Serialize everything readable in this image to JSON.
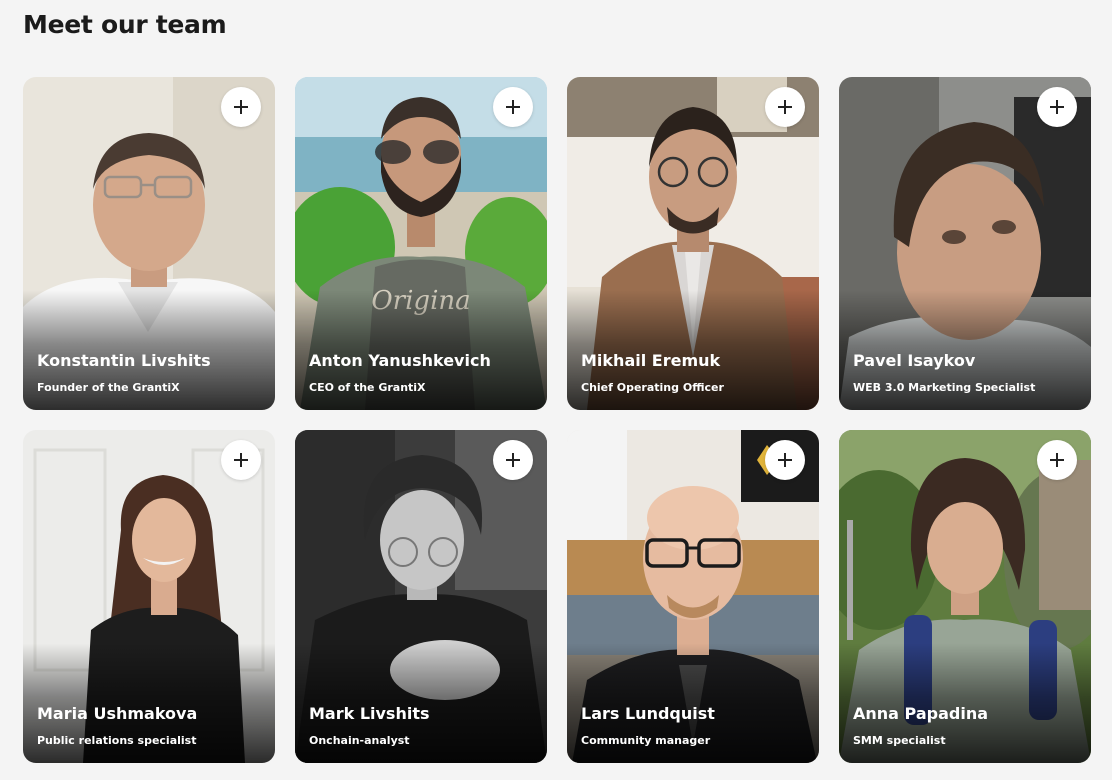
{
  "heading": "Meet our team",
  "team": [
    {
      "name": "Konstantin Livshits",
      "role": "Founder of the GrantiX"
    },
    {
      "name": "Anton Yanushkevich",
      "role": "CEO of the GrantiX"
    },
    {
      "name": "Mikhail Eremuk",
      "role": "Chief Operating Officer"
    },
    {
      "name": "Pavel Isaykov",
      "role": "WEB 3.0 Marketing Specialist"
    },
    {
      "name": "Maria Ushmakova",
      "role": "Public relations specialist"
    },
    {
      "name": "Mark Livshits",
      "role": "Onchain-analyst"
    },
    {
      "name": "Lars Lundquist",
      "role": "Community manager"
    },
    {
      "name": "Anna Papadina",
      "role": "SMM specialist"
    }
  ],
  "icons": {
    "expand": "plus-icon"
  },
  "colors": {
    "background": "#f4f4f4",
    "heading": "#1b1b1b",
    "card_text": "#ffffff",
    "button": "#ffffff"
  }
}
